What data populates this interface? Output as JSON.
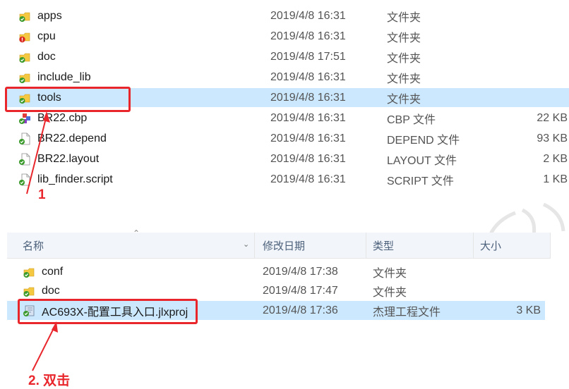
{
  "top_list": [
    {
      "name": "apps",
      "date": "2019/4/8 16:31",
      "type": "文件夹",
      "size": "",
      "icon": "folder-check-icon"
    },
    {
      "name": "cpu",
      "date": "2019/4/8 16:31",
      "type": "文件夹",
      "size": "",
      "icon": "folder-error-icon"
    },
    {
      "name": "doc",
      "date": "2019/4/8 17:51",
      "type": "文件夹",
      "size": "",
      "icon": "folder-check-icon"
    },
    {
      "name": "include_lib",
      "date": "2019/4/8 16:31",
      "type": "文件夹",
      "size": "",
      "icon": "folder-check-icon"
    },
    {
      "name": "tools",
      "date": "2019/4/8 16:31",
      "type": "文件夹",
      "size": "",
      "icon": "folder-check-icon"
    },
    {
      "name": "BR22.cbp",
      "date": "2019/4/8 16:31",
      "type": "CBP 文件",
      "size": "22 KB",
      "icon": "cbp-file-icon"
    },
    {
      "name": "BR22.depend",
      "date": "2019/4/8 16:31",
      "type": "DEPEND 文件",
      "size": "93 KB",
      "icon": "file-check-icon"
    },
    {
      "name": "BR22.layout",
      "date": "2019/4/8 16:31",
      "type": "LAYOUT 文件",
      "size": "2 KB",
      "icon": "file-check-icon"
    },
    {
      "name": "lib_finder.script",
      "date": "2019/4/8 16:31",
      "type": "SCRIPT 文件",
      "size": "1 KB",
      "icon": "file-check-icon"
    }
  ],
  "annotation_1": "1",
  "header": {
    "name": "名称",
    "date": "修改日期",
    "type": "类型",
    "size": "大小"
  },
  "bottom_list": [
    {
      "name": "conf",
      "date": "2019/4/8 17:38",
      "type": "文件夹",
      "size": "",
      "icon": "folder-check-icon"
    },
    {
      "name": "doc",
      "date": "2019/4/8 17:47",
      "type": "文件夹",
      "size": "",
      "icon": "folder-check-icon"
    },
    {
      "name": "AC693X-配置工具入口.jlxproj",
      "date": "2019/4/8 17:36",
      "type": "杰理工程文件",
      "size": "3 KB",
      "icon": "project-file-icon"
    }
  ],
  "annotation_2": "2. 双击",
  "colors": {
    "selection": "#cce8ff",
    "annotation_red": "#e8262c",
    "folder_yellow": "#f5c842",
    "check_green": "#3a9a2b"
  }
}
